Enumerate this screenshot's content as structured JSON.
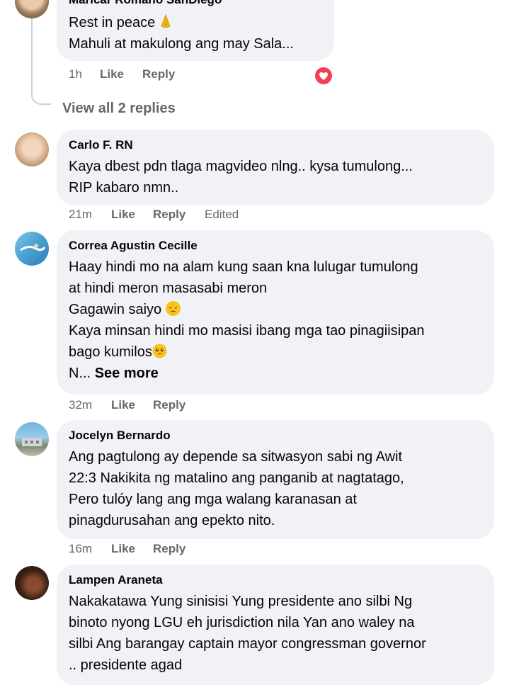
{
  "reply_preview": {
    "author": "Maricar Romano SanDiego",
    "lines": [
      "Rest in peace",
      "Mahuli at makulong ang may Sala..."
    ],
    "emoji": "folded-hands",
    "time": "1h",
    "like": "Like",
    "reply": "Reply",
    "reaction": "heart"
  },
  "view_replies": "View all 2 replies",
  "comments": [
    {
      "author": "Carlo F. RN",
      "lines": [
        "Kaya dbest pdn tlaga magvideo nlng.. kysa tumulong...",
        "RIP kabaro nmn.."
      ],
      "time": "21m",
      "like": "Like",
      "reply": "Reply",
      "edited": "Edited"
    },
    {
      "author": "Correa Agustin Cecille",
      "lines": [
        "Haay hindi mo na alam kung saan kna lulugar tumulong",
        "at hindi meron masasabi meron",
        "Gagawin saiyo",
        "Kaya minsan hindi mo masisi ibang mga tao pinagiisipan",
        "bago kumilos",
        "N..."
      ],
      "see_more": "See more",
      "time": "32m",
      "like": "Like",
      "reply": "Reply"
    },
    {
      "author": "Jocelyn Bernardo",
      "lines": [
        "Ang pagtulong ay depende sa sitwasyon sabi ng Awit",
        "22:3 Nakikita ng matalino ang panganib at nagtatago,",
        "Pero tulóy lang ang mga walang karanasan at",
        "pinagdurusahan ang epekto nito."
      ],
      "time": "16m",
      "like": "Like",
      "reply": "Reply"
    },
    {
      "author": "Lampen Araneta",
      "lines": [
        "Nakakatawa Yung sinisisi Yung presidente ano silbi Ng",
        "binoto nyong LGU eh jurisdiction nila Yan ano waley na",
        "silbi Ang barangay captain mayor congressman governor",
        ".. presidente agad"
      ]
    }
  ],
  "colors": {
    "bubble": "#f0f2f5",
    "meta": "#65676b",
    "heart": "#f33e58"
  }
}
